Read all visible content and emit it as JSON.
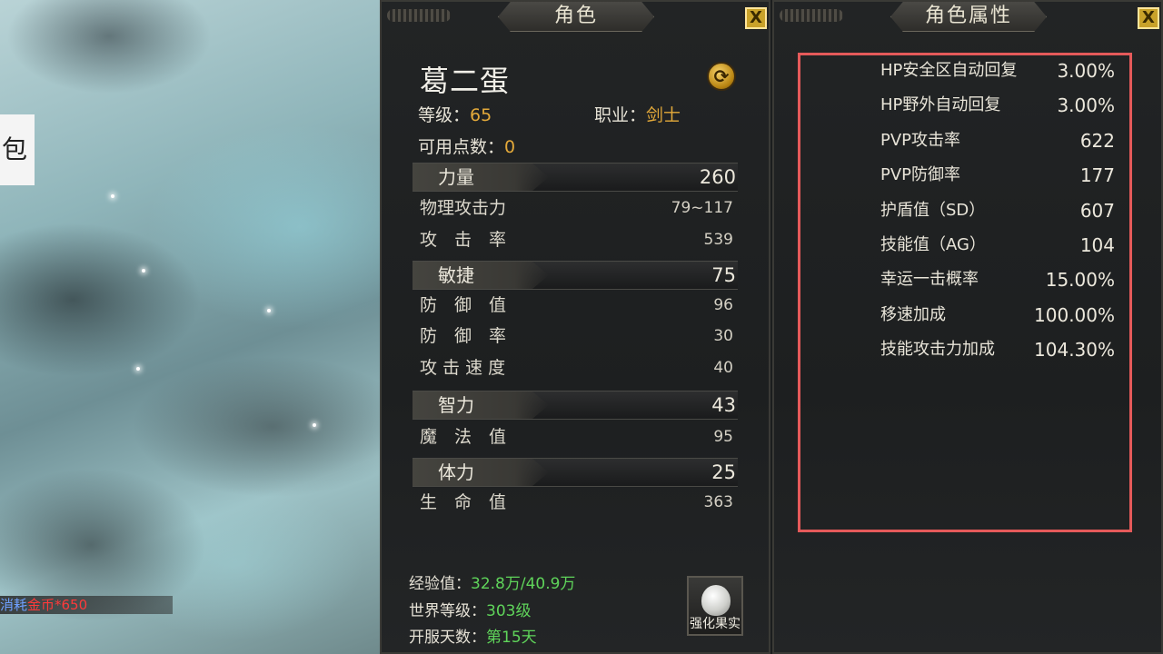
{
  "background": {
    "bag_label": "包",
    "consume_label": "消耗",
    "consume_value": "金币*650"
  },
  "character_panel": {
    "title": "角色",
    "close": "X",
    "name": "葛二蛋",
    "level_label": "等级：",
    "level_value": "65",
    "class_label": "职业：",
    "class_value": "剑士",
    "points_label": "可用点数：",
    "points_value": "0",
    "stats": [
      {
        "name": "力量",
        "value": "260",
        "subs": [
          {
            "label": "物理攻击力",
            "value": "79~117"
          },
          {
            "label": "攻　击　率",
            "value": "539"
          }
        ]
      },
      {
        "name": "敏捷",
        "value": "75",
        "subs": [
          {
            "label": "防　御　值",
            "value": "96"
          },
          {
            "label": "防　御　率",
            "value": "30"
          },
          {
            "label": "攻 击 速 度",
            "value": "40"
          }
        ]
      },
      {
        "name": "智力",
        "value": "43",
        "subs": [
          {
            "label": "魔　法　值",
            "value": "95"
          }
        ]
      },
      {
        "name": "体力",
        "value": "25",
        "subs": [
          {
            "label": "生　命　值",
            "value": "363"
          }
        ]
      }
    ],
    "exp_label": "经验值：",
    "exp_value": "32.8万/40.9万",
    "world_level_label": "世界等级：",
    "world_level_value": "303级",
    "server_days_label": "开服天数：",
    "server_days_value": "第15天",
    "fruit_button": "强化果实"
  },
  "attribute_panel": {
    "title": "角色属性",
    "close": "X",
    "rows": [
      {
        "label": "HP安全区自动回复",
        "value": "3.00%"
      },
      {
        "label": "HP野外自动回复",
        "value": "3.00%"
      },
      {
        "label": "PVP攻击率",
        "value": "622"
      },
      {
        "label": "PVP防御率",
        "value": "177"
      },
      {
        "label": "护盾值（SD）",
        "value": "607"
      },
      {
        "label": "技能值（AG）",
        "value": "104"
      },
      {
        "label": "幸运一击概率",
        "value": "15.00%"
      },
      {
        "label": "移速加成",
        "value": "100.00%"
      },
      {
        "label": "技能攻击力加成",
        "value": "104.30%"
      }
    ]
  },
  "colors": {
    "accent_gold": "#e3a93a",
    "green": "#5fd45a",
    "highlight_border": "#e55a5a"
  }
}
